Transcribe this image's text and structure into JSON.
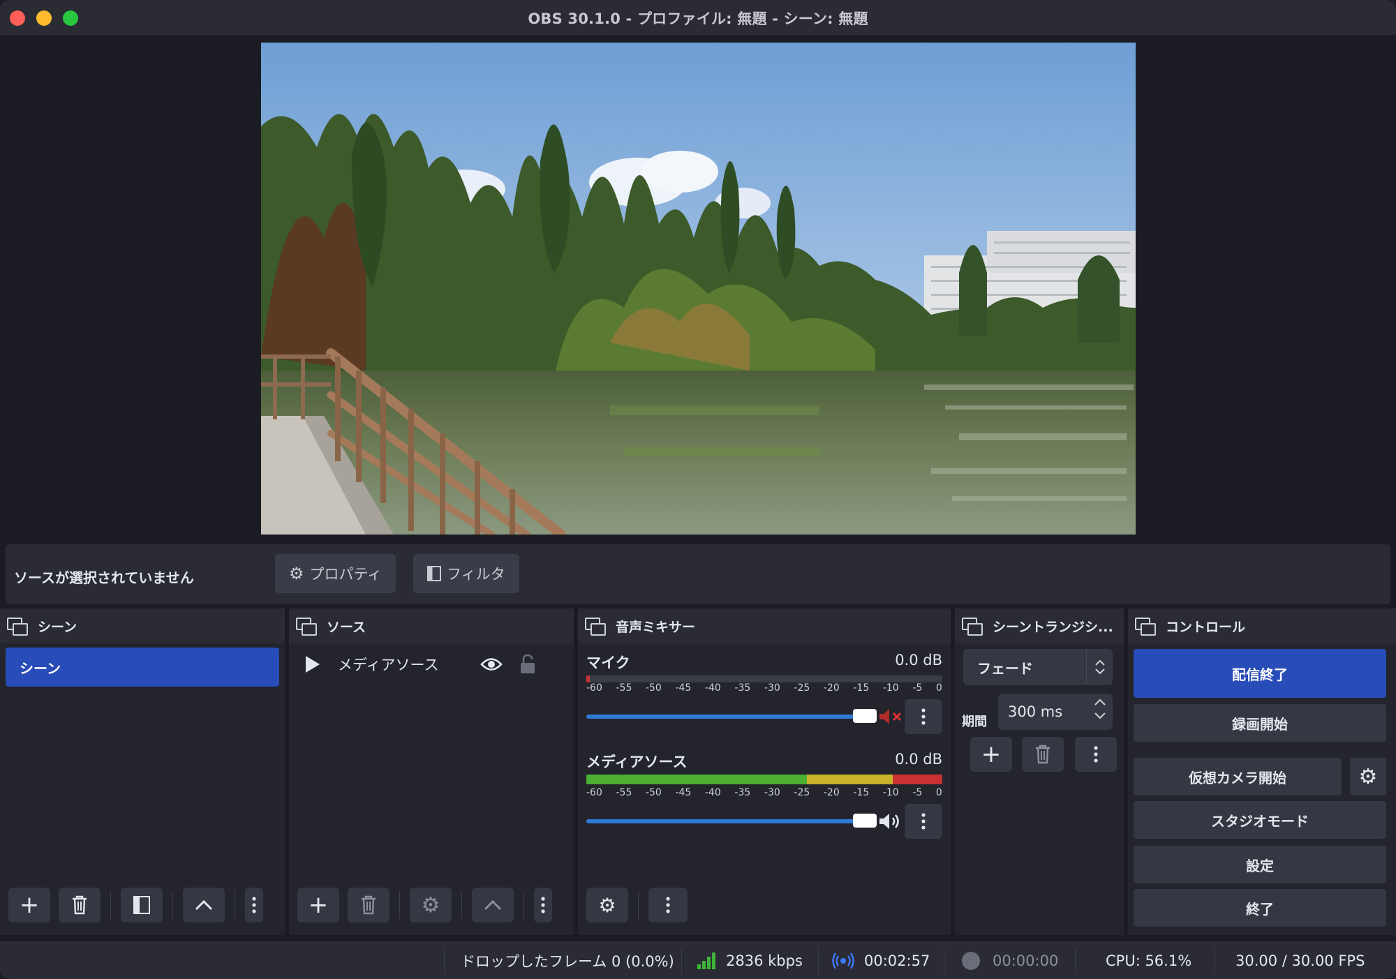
{
  "window": {
    "title": "OBS 30.1.0 - プロファイル: 無題 - シーン: 無題"
  },
  "source_toolbar": {
    "no_source_text": "ソースが選択されていません",
    "properties_label": "プロパティ",
    "filters_label": "フィルタ"
  },
  "docks": {
    "scenes": {
      "title": "シーン",
      "items": [
        "シーン"
      ]
    },
    "sources": {
      "title": "ソース",
      "items": [
        {
          "name": "メディアソース",
          "visible": true,
          "locked": false
        }
      ]
    },
    "mixer": {
      "title": "音声ミキサー",
      "channels": [
        {
          "name": "マイク",
          "db": "0.0 dB",
          "muted": true,
          "level": 0.0
        },
        {
          "name": "メディアソース",
          "db": "0.0 dB",
          "muted": false,
          "level": 1.0
        }
      ],
      "scale": [
        "-60",
        "-55",
        "-50",
        "-45",
        "-40",
        "-35",
        "-30",
        "-25",
        "-20",
        "-15",
        "-10",
        "-5",
        "0"
      ]
    },
    "transitions": {
      "title": "シーントランジシ...",
      "selected": "フェード",
      "duration_label": "期間",
      "duration_value": "300 ms"
    },
    "controls": {
      "title": "コントロール",
      "stop_streaming": "配信終了",
      "start_recording": "録画開始",
      "start_virtual_cam": "仮想カメラ開始",
      "studio_mode": "スタジオモード",
      "settings": "設定",
      "exit": "終了"
    }
  },
  "status": {
    "dropped_frames": "ドロップしたフレーム 0 (0.0%)",
    "bitrate": "2836 kbps",
    "stream_time": "00:02:57",
    "record_time": "00:00:00",
    "cpu": "CPU: 56.1%",
    "fps": "30.00 / 30.00 FPS"
  },
  "colors": {
    "accent": "#284cb8",
    "meter_green": "#4caf32",
    "meter_yellow": "#c8b32a",
    "meter_red": "#c83232",
    "slider": "#2f7bd8"
  }
}
